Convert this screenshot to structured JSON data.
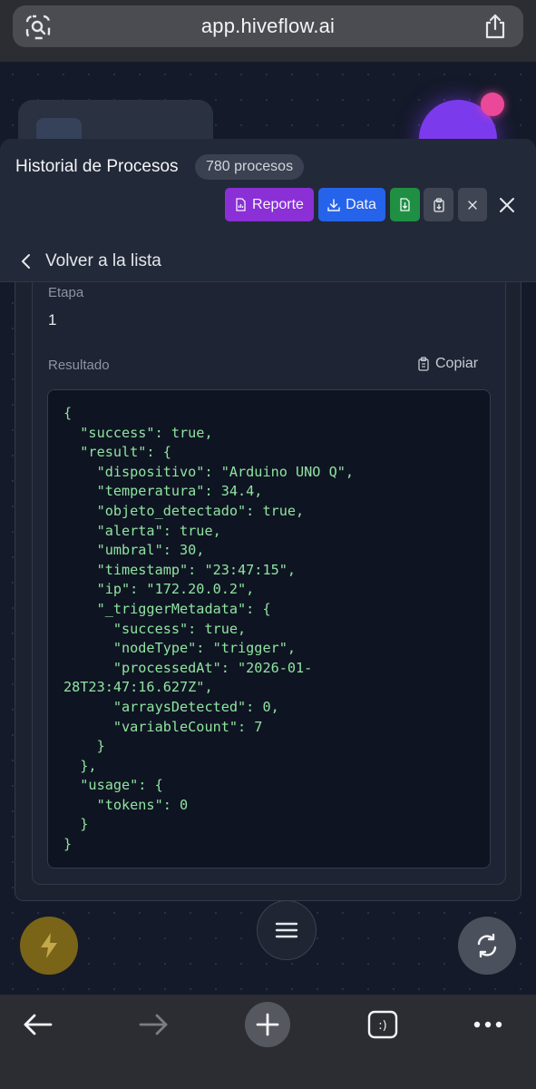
{
  "browser": {
    "url": "app.hiveflow.ai"
  },
  "panel": {
    "title": "Historial de Procesos",
    "count_badge": "780 procesos",
    "buttons": {
      "report": "Reporte",
      "data": "Data"
    },
    "back_label": "Volver a la lista"
  },
  "detail": {
    "stage_label": "Etapa",
    "stage_value": "1",
    "result_label": "Resultado",
    "copy_label": "Copiar",
    "result_json": "{\n  \"success\": true,\n  \"result\": {\n    \"dispositivo\": \"Arduino UNO Q\",\n    \"temperatura\": 34.4,\n    \"objeto_detectado\": true,\n    \"alerta\": true,\n    \"umbral\": 30,\n    \"timestamp\": \"23:47:15\",\n    \"ip\": \"172.20.0.2\",\n    \"_triggerMetadata\": {\n      \"success\": true,\n      \"nodeType\": \"trigger\",\n      \"processedAt\": \"2026-01-\n28T23:47:16.627Z\",\n      \"arraysDetected\": 0,\n      \"variableCount\": 7\n    }\n  },\n  \"usage\": {\n    \"tokens\": 0\n  }\n}"
  },
  "icons": {
    "url_left": "screen-search-icon",
    "url_right": "share-icon",
    "report": "chart-file-icon",
    "data": "download-icon",
    "export": "file-download-icon",
    "copy": "clipboard-icon",
    "x_small": "x-icon",
    "close": "close-icon",
    "back": "chevron-left-icon",
    "bolt": "lightning-icon",
    "menu": "hamburger-icon",
    "refresh": "refresh-icon",
    "toolbar_back": "arrow-left-icon",
    "toolbar_forward": "arrow-right-icon",
    "toolbar_new_tab": "plus-icon",
    "toolbar_tabs": "tabs-icon",
    "toolbar_more": "more-icon"
  },
  "colors": {
    "report_button": "#8b2fd6",
    "data_button": "#2563eb",
    "export_button": "#1f8f43",
    "code_text": "#8fe3a0",
    "bolt_button": "#7a6418"
  }
}
